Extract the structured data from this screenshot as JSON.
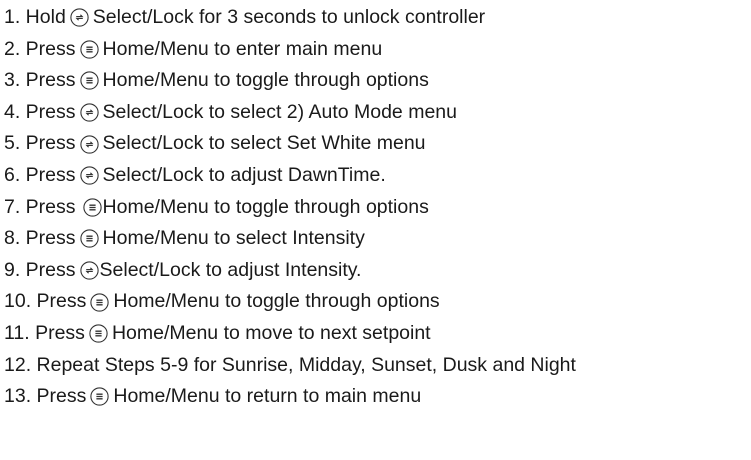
{
  "steps": [
    {
      "prefix": "1. Hold",
      "icon": "select-lock-icon",
      "text": "Select/Lock for 3 seconds to unlock controller"
    },
    {
      "prefix": "2. Press",
      "icon": "home-menu-icon",
      "text": "Home/Menu to enter main menu"
    },
    {
      "prefix": "3. Press",
      "icon": "home-menu-icon",
      "text": "Home/Menu to toggle through options"
    },
    {
      "prefix": "4. Press",
      "icon": "select-lock-icon",
      "text": "Select/Lock to select 2) Auto Mode menu"
    },
    {
      "prefix": "5. Press",
      "icon": "select-lock-icon",
      "text": "Select/Lock to select Set White menu"
    },
    {
      "prefix": "6. Press",
      "icon": "select-lock-icon",
      "text": "Select/Lock to adjust DawnTime."
    },
    {
      "prefix": "7. Press",
      "icon": "home-menu-icon",
      "text": "Home/Menu to toggle through options"
    },
    {
      "prefix": "8. Press",
      "icon": "home-menu-icon",
      "text": "Home/Menu to select Intensity"
    },
    {
      "prefix": "9. Press",
      "icon": "select-lock-icon",
      "text": "Select/Lock to adjust Intensity."
    },
    {
      "prefix": "10. Press",
      "icon": "home-menu-icon",
      "text": "Home/Menu to toggle through options"
    },
    {
      "prefix": "11. Press",
      "icon": "home-menu-icon",
      "text": "Home/Menu to move to next setpoint"
    },
    {
      "prefix": "12. Repeat Steps 5-9 for Sunrise, Midday, Sunset, Dusk and Night",
      "icon": "",
      "text": ""
    },
    {
      "prefix": "13. Press",
      "icon": "home-menu-icon",
      "text": "Home/Menu to return to main menu"
    }
  ]
}
